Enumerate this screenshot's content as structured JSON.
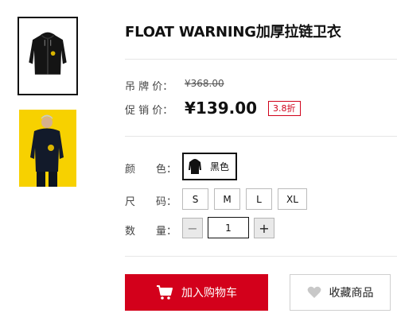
{
  "product": {
    "title": "FLOAT WARNING加厚拉链卫衣"
  },
  "thumbnails": [
    {
      "icon": "hoodie-product-image",
      "selected": true
    },
    {
      "icon": "model-wearing-hoodie-image",
      "background": "#f7d100"
    }
  ],
  "price": {
    "original_label": "吊 牌 价：",
    "original_value": "¥368.00",
    "sale_label": "促 销 价：",
    "sale_value": "¥139.00",
    "discount_badge": "3.8折"
  },
  "color": {
    "label": "颜　　色：",
    "options": [
      {
        "name": "黑色",
        "icon": "black-hoodie-swatch",
        "selected": true
      }
    ]
  },
  "size": {
    "label": "尺　　码：",
    "options": [
      "S",
      "M",
      "L",
      "XL"
    ]
  },
  "quantity": {
    "label": "数　　量：",
    "minus": "−",
    "value": "1",
    "plus": "+"
  },
  "actions": {
    "add_to_cart": "加入购物车",
    "add_to_cart_icon": "cart-icon",
    "favorite": "收藏商品",
    "favorite_icon": "heart-icon"
  },
  "colors": {
    "accent": "#d3001b",
    "badge": "#d0021b",
    "divider": "#e6e6e6"
  }
}
